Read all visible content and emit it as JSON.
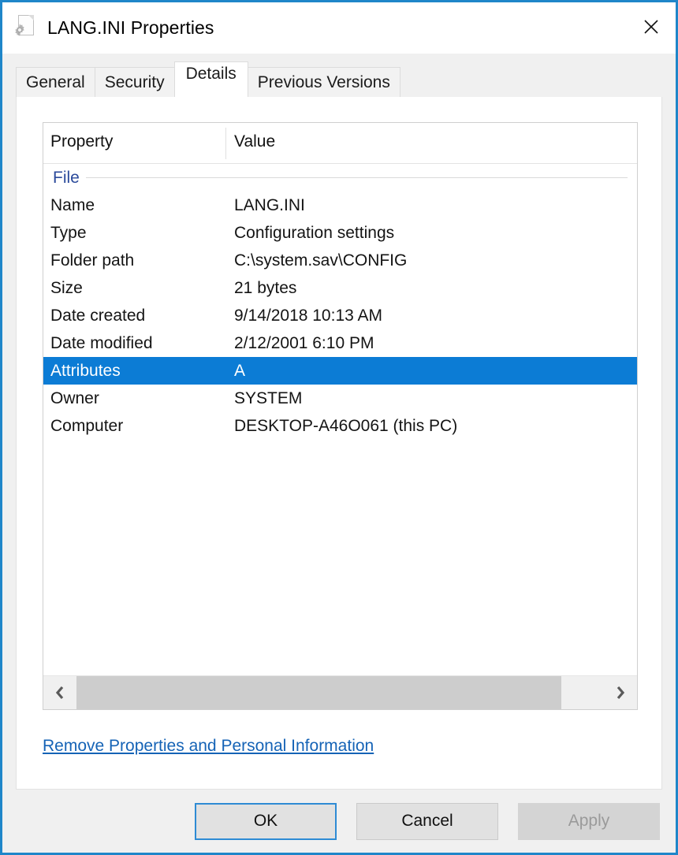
{
  "window": {
    "title": "LANG.INI Properties",
    "icon": "configuration-settings-file-icon",
    "close_label": "✕",
    "accent_color": "#1f86c9"
  },
  "tabs": [
    {
      "label": "General",
      "selected": false
    },
    {
      "label": "Security",
      "selected": false
    },
    {
      "label": "Details",
      "selected": true
    },
    {
      "label": "Previous Versions",
      "selected": false
    }
  ],
  "details": {
    "columns": {
      "property": "Property",
      "value": "Value"
    },
    "sections": [
      {
        "title": "File",
        "rows": [
          {
            "property": "Name",
            "value": "LANG.INI",
            "selected": false
          },
          {
            "property": "Type",
            "value": "Configuration settings",
            "selected": false
          },
          {
            "property": "Folder path",
            "value": "C:\\system.sav\\CONFIG",
            "selected": false
          },
          {
            "property": "Size",
            "value": "21 bytes",
            "selected": false
          },
          {
            "property": "Date created",
            "value": "9/14/2018 10:13 AM",
            "selected": false
          },
          {
            "property": "Date modified",
            "value": "2/12/2001 6:10 PM",
            "selected": false
          },
          {
            "property": "Attributes",
            "value": "A",
            "selected": true
          },
          {
            "property": "Owner",
            "value": "SYSTEM",
            "selected": false
          },
          {
            "property": "Computer",
            "value": "DESKTOP-A46O061 (this PC)",
            "selected": false
          }
        ]
      }
    ],
    "selection_color": "#0c7cd5",
    "section_color": "#2b4a9b",
    "scrollbar": {
      "left_arrow": "‹",
      "right_arrow": "›",
      "thumb_percent": 92
    },
    "privacy_link": "Remove Properties and Personal Information"
  },
  "buttons": {
    "ok": "OK",
    "cancel": "Cancel",
    "apply": "Apply"
  }
}
